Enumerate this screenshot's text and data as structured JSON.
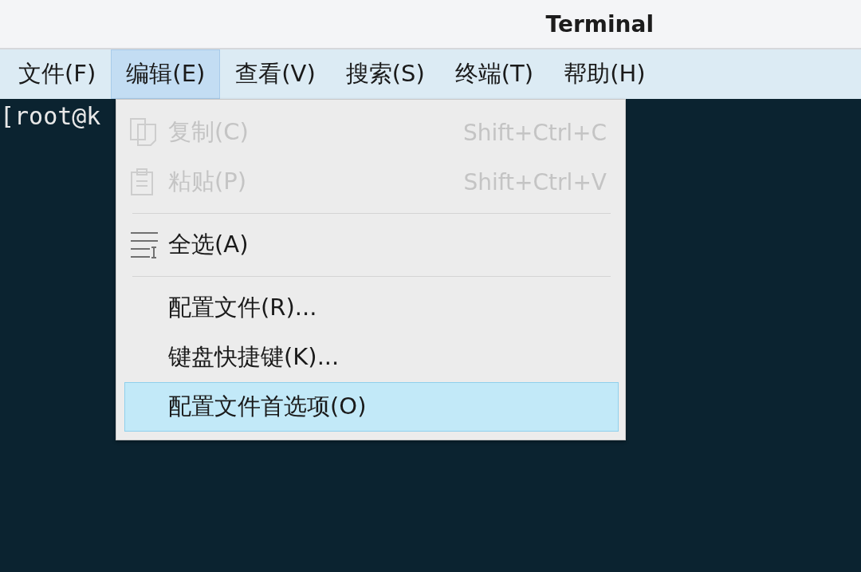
{
  "window": {
    "title": "Terminal"
  },
  "menubar": [
    {
      "label": "文件(F)",
      "selected": false
    },
    {
      "label": "编辑(E)",
      "selected": true
    },
    {
      "label": "查看(V)",
      "selected": false
    },
    {
      "label": "搜索(S)",
      "selected": false
    },
    {
      "label": "终端(T)",
      "selected": false
    },
    {
      "label": "帮助(H)",
      "selected": false
    }
  ],
  "terminal": {
    "line": "[root@k"
  },
  "edit_menu": [
    {
      "kind": "copy",
      "label": "复制(C)",
      "shortcut": "Shift+Ctrl+C",
      "disabled": true,
      "selected": false
    },
    {
      "kind": "paste",
      "label": "粘贴(P)",
      "shortcut": "Shift+Ctrl+V",
      "disabled": true,
      "selected": false
    },
    {
      "kind": "separator"
    },
    {
      "kind": "select-all",
      "label": "全选(A)",
      "disabled": false,
      "selected": false
    },
    {
      "kind": "separator"
    },
    {
      "kind": "item",
      "label": "配置文件(R)...",
      "disabled": false,
      "selected": false
    },
    {
      "kind": "item",
      "label": "键盘快捷键(K)...",
      "disabled": false,
      "selected": false
    },
    {
      "kind": "item",
      "label": "配置文件首选项(O)",
      "disabled": false,
      "selected": true
    }
  ]
}
